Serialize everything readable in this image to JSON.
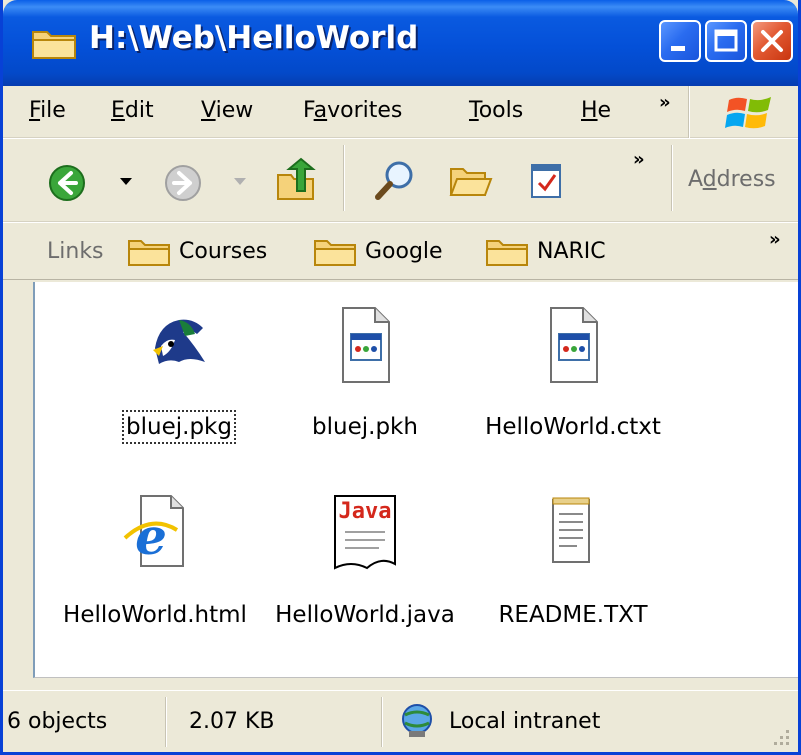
{
  "window": {
    "title": "H:\\Web\\HelloWorld",
    "title_icon": "folder-icon"
  },
  "menu": {
    "items": [
      {
        "label_ul": "F",
        "label_rest": "ile"
      },
      {
        "label_ul": "E",
        "label_rest": "dit"
      },
      {
        "label_ul": "V",
        "label_rest": "iew"
      },
      {
        "label_pre": "F",
        "label_ul": "a",
        "label_rest": "vorites"
      },
      {
        "label_ul": "T",
        "label_rest": "ools"
      },
      {
        "label_ul": "H",
        "label_rest": "e"
      }
    ],
    "chevron": "»"
  },
  "toolbar": {
    "icons": [
      "back-icon",
      "dropdown-icon",
      "forward-icon",
      "up-folder-icon",
      "search-icon",
      "folders-icon",
      "task-icon"
    ],
    "chevron": "»",
    "address_pre": "A",
    "address_ul": "d",
    "address_rest": "dress"
  },
  "links": {
    "label": "Links",
    "items": [
      "Courses",
      "Google",
      "NARIC"
    ],
    "chevron": "»"
  },
  "files": [
    {
      "name": "bluej.pkg",
      "icon": "bluej-bird-icon",
      "focused": true
    },
    {
      "name": "bluej.pkh",
      "icon": "generic-file-icon"
    },
    {
      "name": "HelloWorld.ctxt",
      "icon": "generic-file-icon"
    },
    {
      "name": "HelloWorld.html",
      "icon": "ie-document-icon"
    },
    {
      "name": "HelloWorld.java",
      "icon": "java-file-icon"
    },
    {
      "name": "README.TXT",
      "icon": "notepad-text-icon"
    }
  ],
  "status": {
    "objects": "6 objects",
    "size": "2.07 KB",
    "zone": "Local intranet"
  },
  "colors": {
    "titlebar": "#0450d8",
    "chrome": "#ece9d8",
    "content_bg": "#ffffff"
  }
}
